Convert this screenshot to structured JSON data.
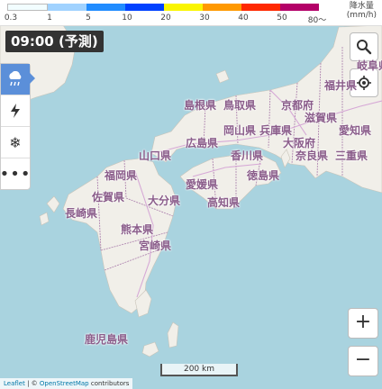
{
  "legend": {
    "ticks": [
      "0.3",
      "1",
      "5",
      "10",
      "20",
      "30",
      "40",
      "50",
      "80～"
    ],
    "colors": [
      "#f2fdff",
      "#a0d2ff",
      "#218cff",
      "#0041ff",
      "#faf500",
      "#ff9900",
      "#ff2800",
      "#b40068"
    ],
    "unit_line1": "降水量",
    "unit_line2": "(mm/h)"
  },
  "time_label": "09:00 (予測)",
  "layers": [
    {
      "icon": "rain-cloud-icon",
      "active": true
    },
    {
      "icon": "lightning-icon",
      "active": false
    },
    {
      "icon": "snowflake-icon",
      "active": false
    },
    {
      "icon": "more-icon",
      "active": false
    }
  ],
  "controls": {
    "search_icon": "search-icon",
    "locate_icon": "locate-icon"
  },
  "zoom": {
    "in_label": "+",
    "out_label": "−"
  },
  "scale_label": "200 km",
  "attribution": {
    "leaflet": "Leaflet",
    "sep": " | © ",
    "osm": "OpenStreetMap",
    "contrib": " contributors"
  },
  "prefectures": [
    "福井県",
    "島根県",
    "鳥取県",
    "京都府",
    "滋賀県",
    "広島県",
    "岡山県",
    "兵庫県",
    "大阪府",
    "愛知県",
    "山口県",
    "香川県",
    "奈良県",
    "三重県",
    "福岡県",
    "徳島県",
    "愛媛県",
    "佐賀県",
    "大分県",
    "高知県",
    "長崎県",
    "熊本県",
    "宮崎県",
    "鹿児島県",
    "岐阜県"
  ],
  "colors": {
    "sea": "#a9d3df",
    "land": "#f1efe9",
    "border": "#b28ab2",
    "road": "#d6a8d6"
  }
}
